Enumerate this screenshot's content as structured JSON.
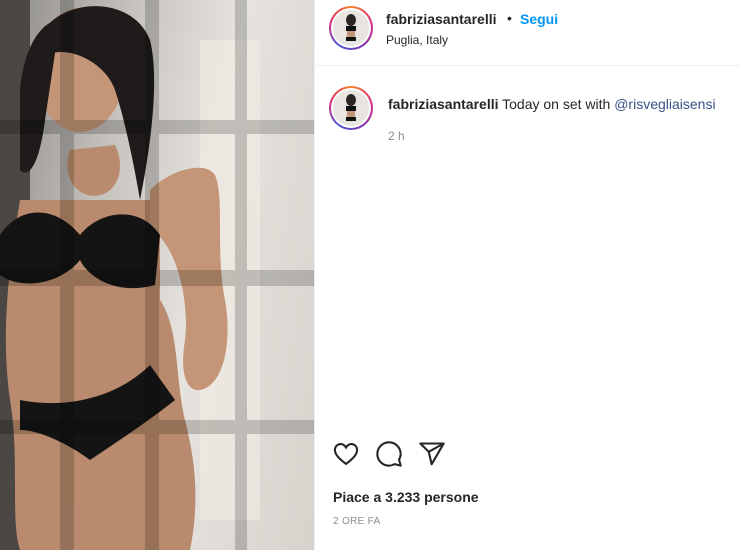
{
  "post": {
    "author": "fabriziasantarelli",
    "follow_label": "Segui",
    "separator": "•",
    "location": "Puglia, Italy",
    "caption": {
      "username": "fabriziasantarelli",
      "text": "Today on set with ",
      "mention": "@risvegliaisensi"
    },
    "caption_time": "2 h",
    "likes_text": "Piace a 3.233 persone",
    "timestamp": "2 ORE FA"
  },
  "icons": {
    "like": "heart-icon",
    "comment": "comment-bubble-icon",
    "share": "paper-plane-icon"
  },
  "colors": {
    "follow": "#0095f6",
    "mention": "#385185",
    "muted": "#8e8e8e",
    "text": "#262626"
  }
}
